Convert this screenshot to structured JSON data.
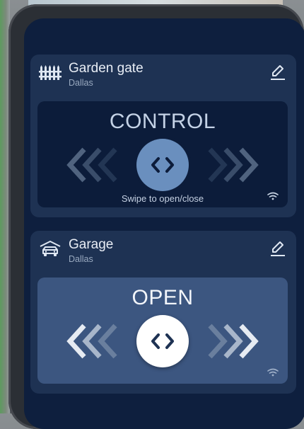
{
  "devices": [
    {
      "name": "Garden gate",
      "location": "Dallas",
      "icon": "fence-icon",
      "action_label": "CONTROL",
      "hint": "Swipe to open/close"
    },
    {
      "name": "Garage",
      "location": "Dallas",
      "icon": "car-icon",
      "action_label": "OPEN",
      "hint": ""
    }
  ],
  "colors": {
    "screen_bg": "#0e1f3e",
    "card_bg": "#1e3253",
    "panel_dark": "#0c1c3a",
    "panel_light": "#3c5680",
    "knob_blue": "#6a8fbe",
    "knob_white": "#ffffff"
  }
}
